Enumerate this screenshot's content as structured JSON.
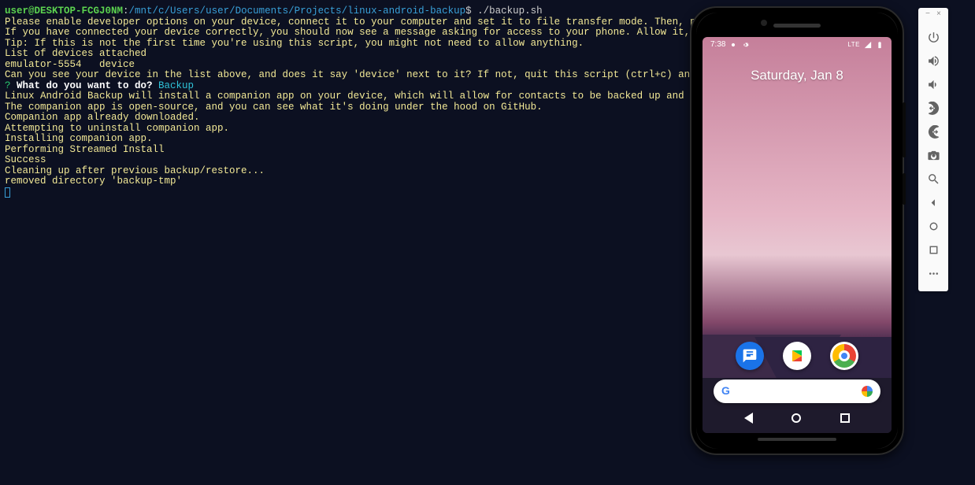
{
  "terminal": {
    "prompt_user": "user@DESKTOP-FCGJ0NM",
    "prompt_colon": ":",
    "prompt_path": "/mnt/c/Users/user/Documents/Projects/linux-android-backup",
    "prompt_dollar": "$ ",
    "command": "./backup.sh",
    "lines": [
      "Please enable developer options on your device, connect it to your computer and set it to file transfer mode. Then, press Enter to continue.",
      "",
      "If you have connected your device correctly, you should now see a message asking for access to your phone. Allow it, then press Enter to go to",
      "Tip: If this is not the first time you're using this script, you might not need to allow anything.",
      "",
      "List of devices attached",
      "emulator-5554   device",
      "",
      "Can you see your device in the list above, and does it say 'device' next to it? If not, quit this script (ctrl+c) and try again."
    ],
    "question_mark": "?",
    "question_text": " What do you want to do? ",
    "question_answer": "Backup",
    "lines2": [
      "Linux Android Backup will install a companion app on your device, which will allow for contacts to be backed up and restored.",
      "The companion app is open-source, and you can see what it's doing under the hood on GitHub.",
      "Companion app already downloaded.",
      "Attempting to uninstall companion app.",
      "Installing companion app.",
      "Performing Streamed Install",
      "Success",
      "Cleaning up after previous backup/restore...",
      "removed directory 'backup-tmp'"
    ]
  },
  "toolbar": {
    "min": "−",
    "close": "×"
  },
  "phone": {
    "time": "7:38",
    "signal": "LTE",
    "date": "Saturday, Jan 8",
    "search_placeholder": ""
  }
}
